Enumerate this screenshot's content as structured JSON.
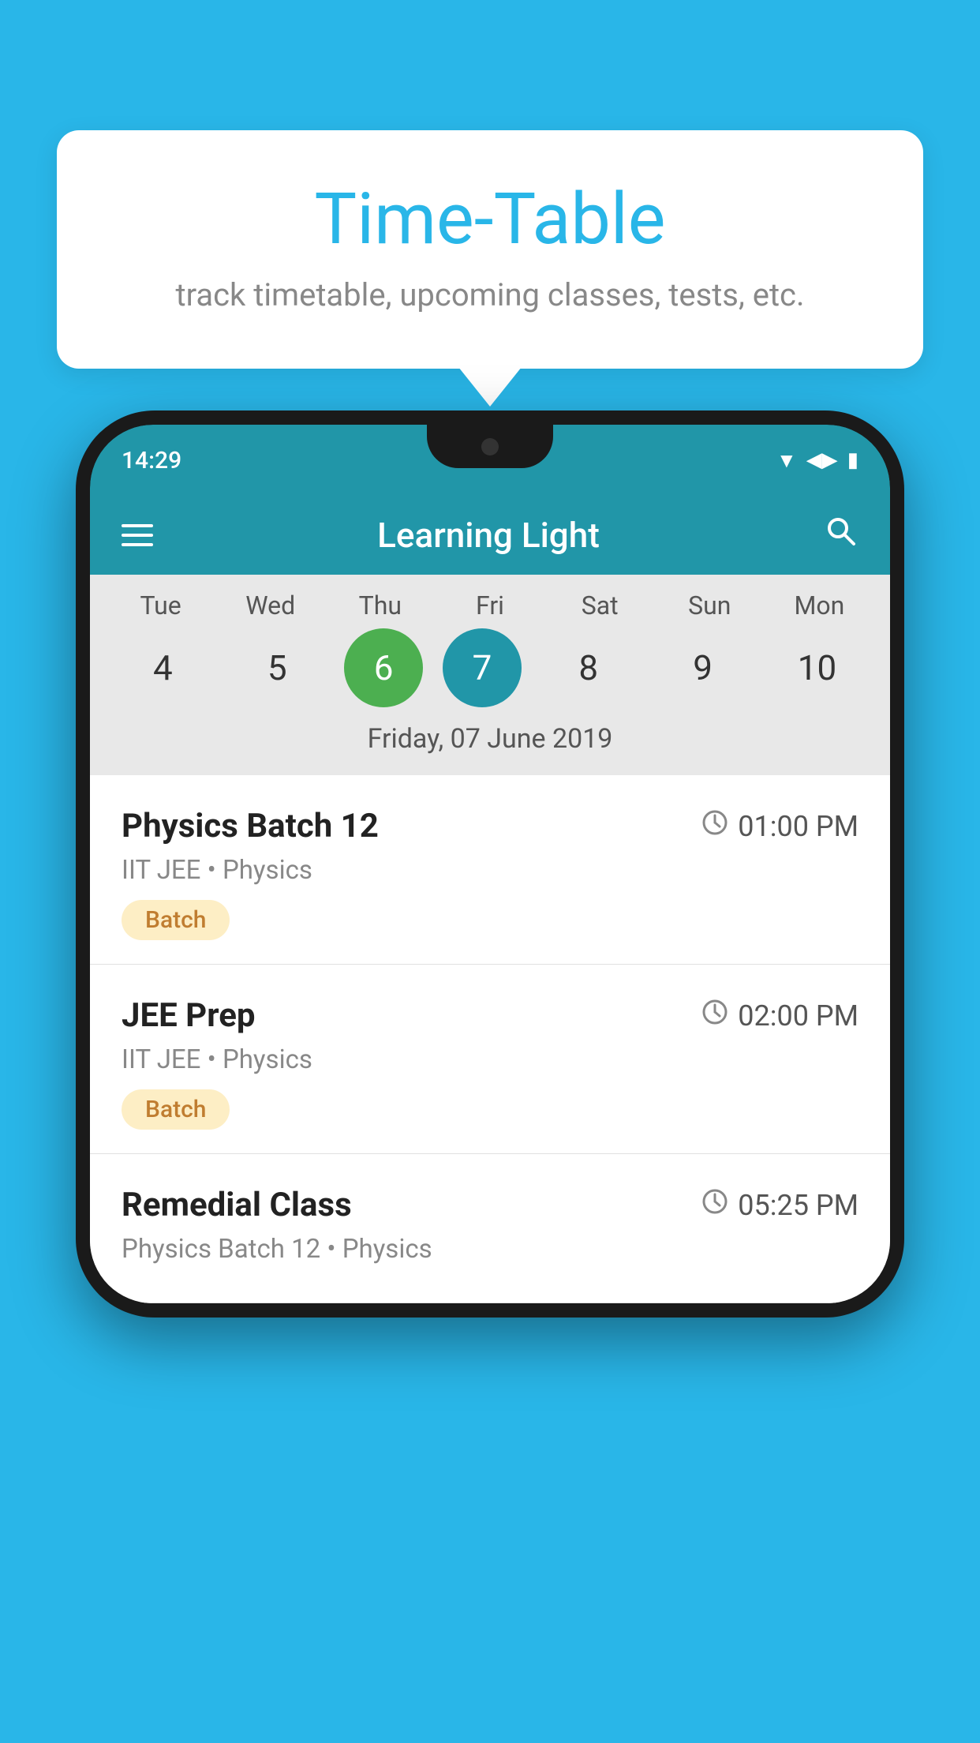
{
  "background_color": "#29b6e8",
  "bubble": {
    "title": "Time-Table",
    "subtitle": "track timetable, upcoming classes, tests, etc."
  },
  "phone": {
    "status_bar": {
      "time": "14:29"
    },
    "app_bar": {
      "title": "Learning Light"
    },
    "calendar": {
      "days": [
        {
          "label": "Tue",
          "number": "4",
          "state": "normal"
        },
        {
          "label": "Wed",
          "number": "5",
          "state": "normal"
        },
        {
          "label": "Thu",
          "number": "6",
          "state": "today"
        },
        {
          "label": "Fri",
          "number": "7",
          "state": "selected"
        },
        {
          "label": "Sat",
          "number": "8",
          "state": "normal"
        },
        {
          "label": "Sun",
          "number": "9",
          "state": "normal"
        },
        {
          "label": "Mon",
          "number": "10",
          "state": "normal"
        }
      ],
      "selected_date_label": "Friday, 07 June 2019"
    },
    "schedule": [
      {
        "title": "Physics Batch 12",
        "time": "01:00 PM",
        "subtitle": "IIT JEE • Physics",
        "badge": "Batch"
      },
      {
        "title": "JEE Prep",
        "time": "02:00 PM",
        "subtitle": "IIT JEE • Physics",
        "badge": "Batch"
      },
      {
        "title": "Remedial Class",
        "time": "05:25 PM",
        "subtitle": "Physics Batch 12 • Physics",
        "badge": ""
      }
    ]
  }
}
